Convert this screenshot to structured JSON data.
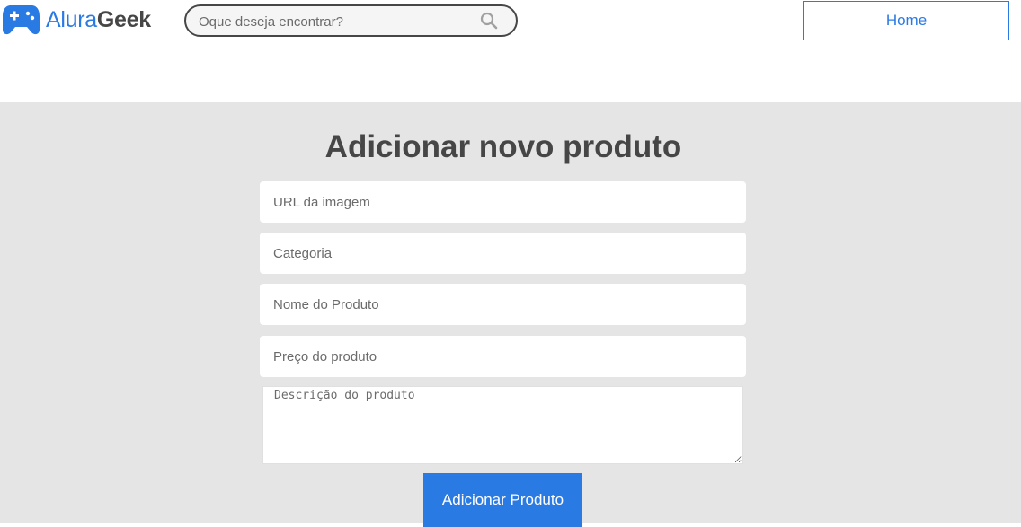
{
  "header": {
    "logo": {
      "brand_part1": "Alura",
      "brand_part2": "Geek",
      "icon": "gamepad-icon"
    },
    "search": {
      "placeholder": "Oque deseja encontrar?",
      "value": "",
      "icon": "search-icon"
    },
    "home_label": "Home"
  },
  "form": {
    "title": "Adicionar novo produto",
    "fields": [
      {
        "placeholder": "URL da imagem",
        "value": ""
      },
      {
        "placeholder": "Categoria",
        "value": ""
      },
      {
        "placeholder": "Nome do Produto",
        "value": ""
      },
      {
        "placeholder": "Preço do produto",
        "value": ""
      }
    ],
    "description": {
      "placeholder": "Descrição do produto",
      "value": ""
    },
    "submit_label": "Adicionar Produto"
  },
  "colors": {
    "accent": "#2a7ae4",
    "text_dark": "#464646",
    "background_gray": "#e5e5e5",
    "white": "#ffffff"
  }
}
